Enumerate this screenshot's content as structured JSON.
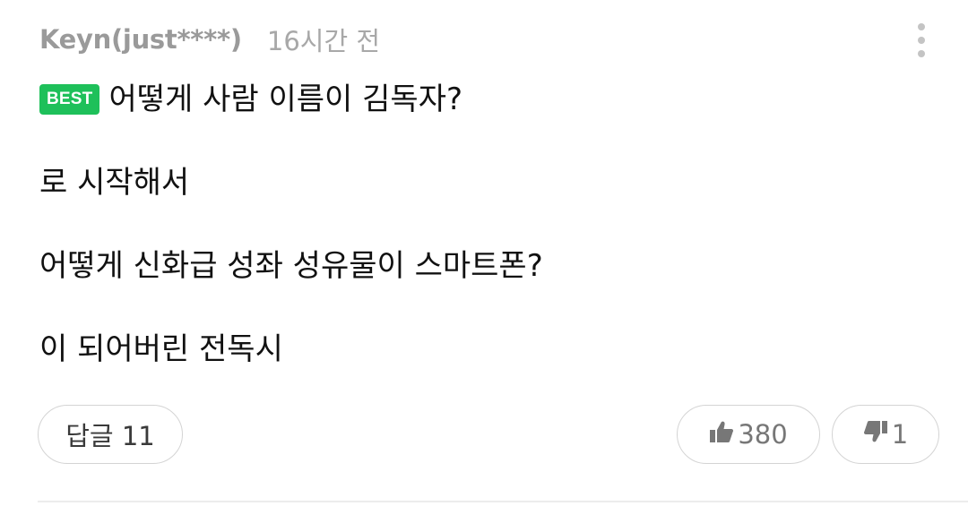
{
  "comment": {
    "author": "Keyn(just****)",
    "time": "16시간 전",
    "badge": "BEST",
    "lines": [
      "어떻게 사람 이름이 김독자?",
      "로 시작해서",
      "어떻게 신화급 성좌 성유물이 스마트폰?",
      "이 되어버린 전독시"
    ],
    "reply_label": "답글 11",
    "likes": "380",
    "dislikes": "1"
  },
  "icons": {
    "more": "more-vertical-icon",
    "like": "thumbs-up-icon",
    "dislike": "thumbs-down-icon"
  },
  "colors": {
    "best_badge": "#1ec05a",
    "meta_text": "#9a9a9a",
    "body_text": "#111111",
    "button_border": "#d4d4d4"
  }
}
